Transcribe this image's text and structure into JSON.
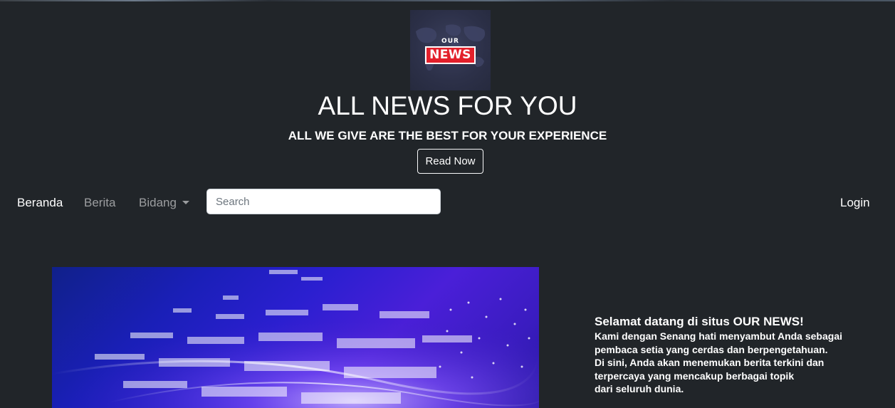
{
  "header": {
    "logo": {
      "top_text": "OUR",
      "main_text": "NEWS",
      "colors": {
        "background": "#2c3048",
        "badge": "#e3202b",
        "text": "#ffffff"
      }
    },
    "title": "ALL NEWS FOR YOU",
    "subtitle": "ALL WE GIVE ARE THE BEST FOR YOUR EXPERIENCE",
    "read_button_label": "Read Now"
  },
  "navbar": {
    "links": [
      {
        "label": "Beranda",
        "active": true
      },
      {
        "label": "Berita",
        "active": false
      },
      {
        "label": "Bidang",
        "active": false,
        "dropdown": true
      }
    ],
    "search": {
      "placeholder": "Search",
      "value": ""
    },
    "login_label": "Login"
  },
  "main": {
    "hero_image": {
      "icon": "digital-data-waves-image"
    },
    "welcome": {
      "title": "Selamat datang di situs OUR NEWS!",
      "lines": [
        "Kami dengan Senang hati menyambut Anda sebagai",
        "pembaca setia yang cerdas dan berpengetahuan.",
        "Di sini, Anda akan menemukan berita terkini dan",
        "terpercaya yang mencakup berbagai topik",
        "dari seluruh dunia."
      ]
    }
  },
  "theme": {
    "page_background": "#212529",
    "text_primary": "#ffffff",
    "text_muted": "rgba(255,255,255,0.55)"
  }
}
